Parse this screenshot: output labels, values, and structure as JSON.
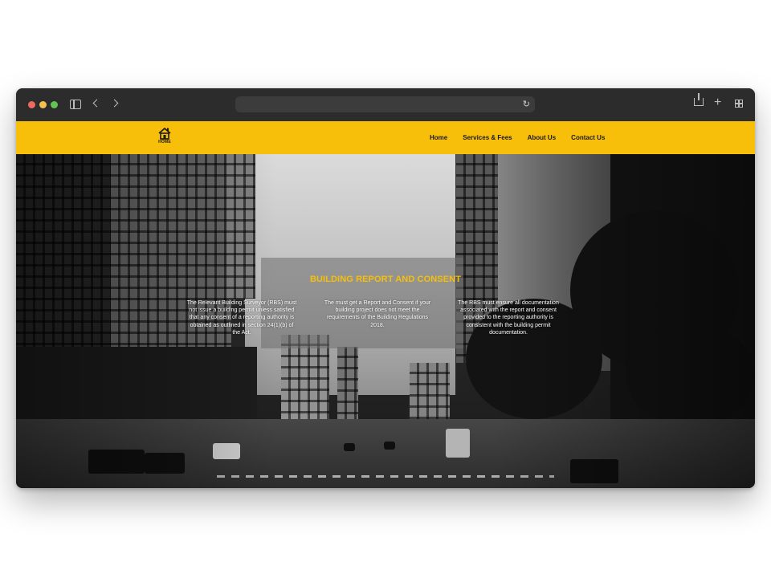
{
  "browser": {
    "url": "",
    "icons": [
      "sidebar-icon",
      "back-icon",
      "forward-icon",
      "reload-icon",
      "share-icon",
      "new-tab-icon",
      "tab-overview-icon"
    ]
  },
  "site": {
    "logo_text": "HOME",
    "accent_color": "#f7bf0a",
    "nav": [
      {
        "label": "Home"
      },
      {
        "label": "Services & Fees"
      },
      {
        "label": "About Us"
      },
      {
        "label": "Contact Us"
      }
    ]
  },
  "hero": {
    "title": "BUILDING REPORT AND CONSENT",
    "columns": [
      {
        "text": "The Relevant Building Surveyor (RBS) must not issue a building permit unless satisfied that any consent of a reporting authority is obtained as outlined in section 24(1)(b) of the Act."
      },
      {
        "text": "The must get a Report and Consent if your building project does not meet the requirements of the Building Regulations 2018."
      },
      {
        "text": "The RBS must ensure all documentation associated with the report and consent provided to the reporting authority is consistent with the building permit documentation."
      }
    ]
  }
}
